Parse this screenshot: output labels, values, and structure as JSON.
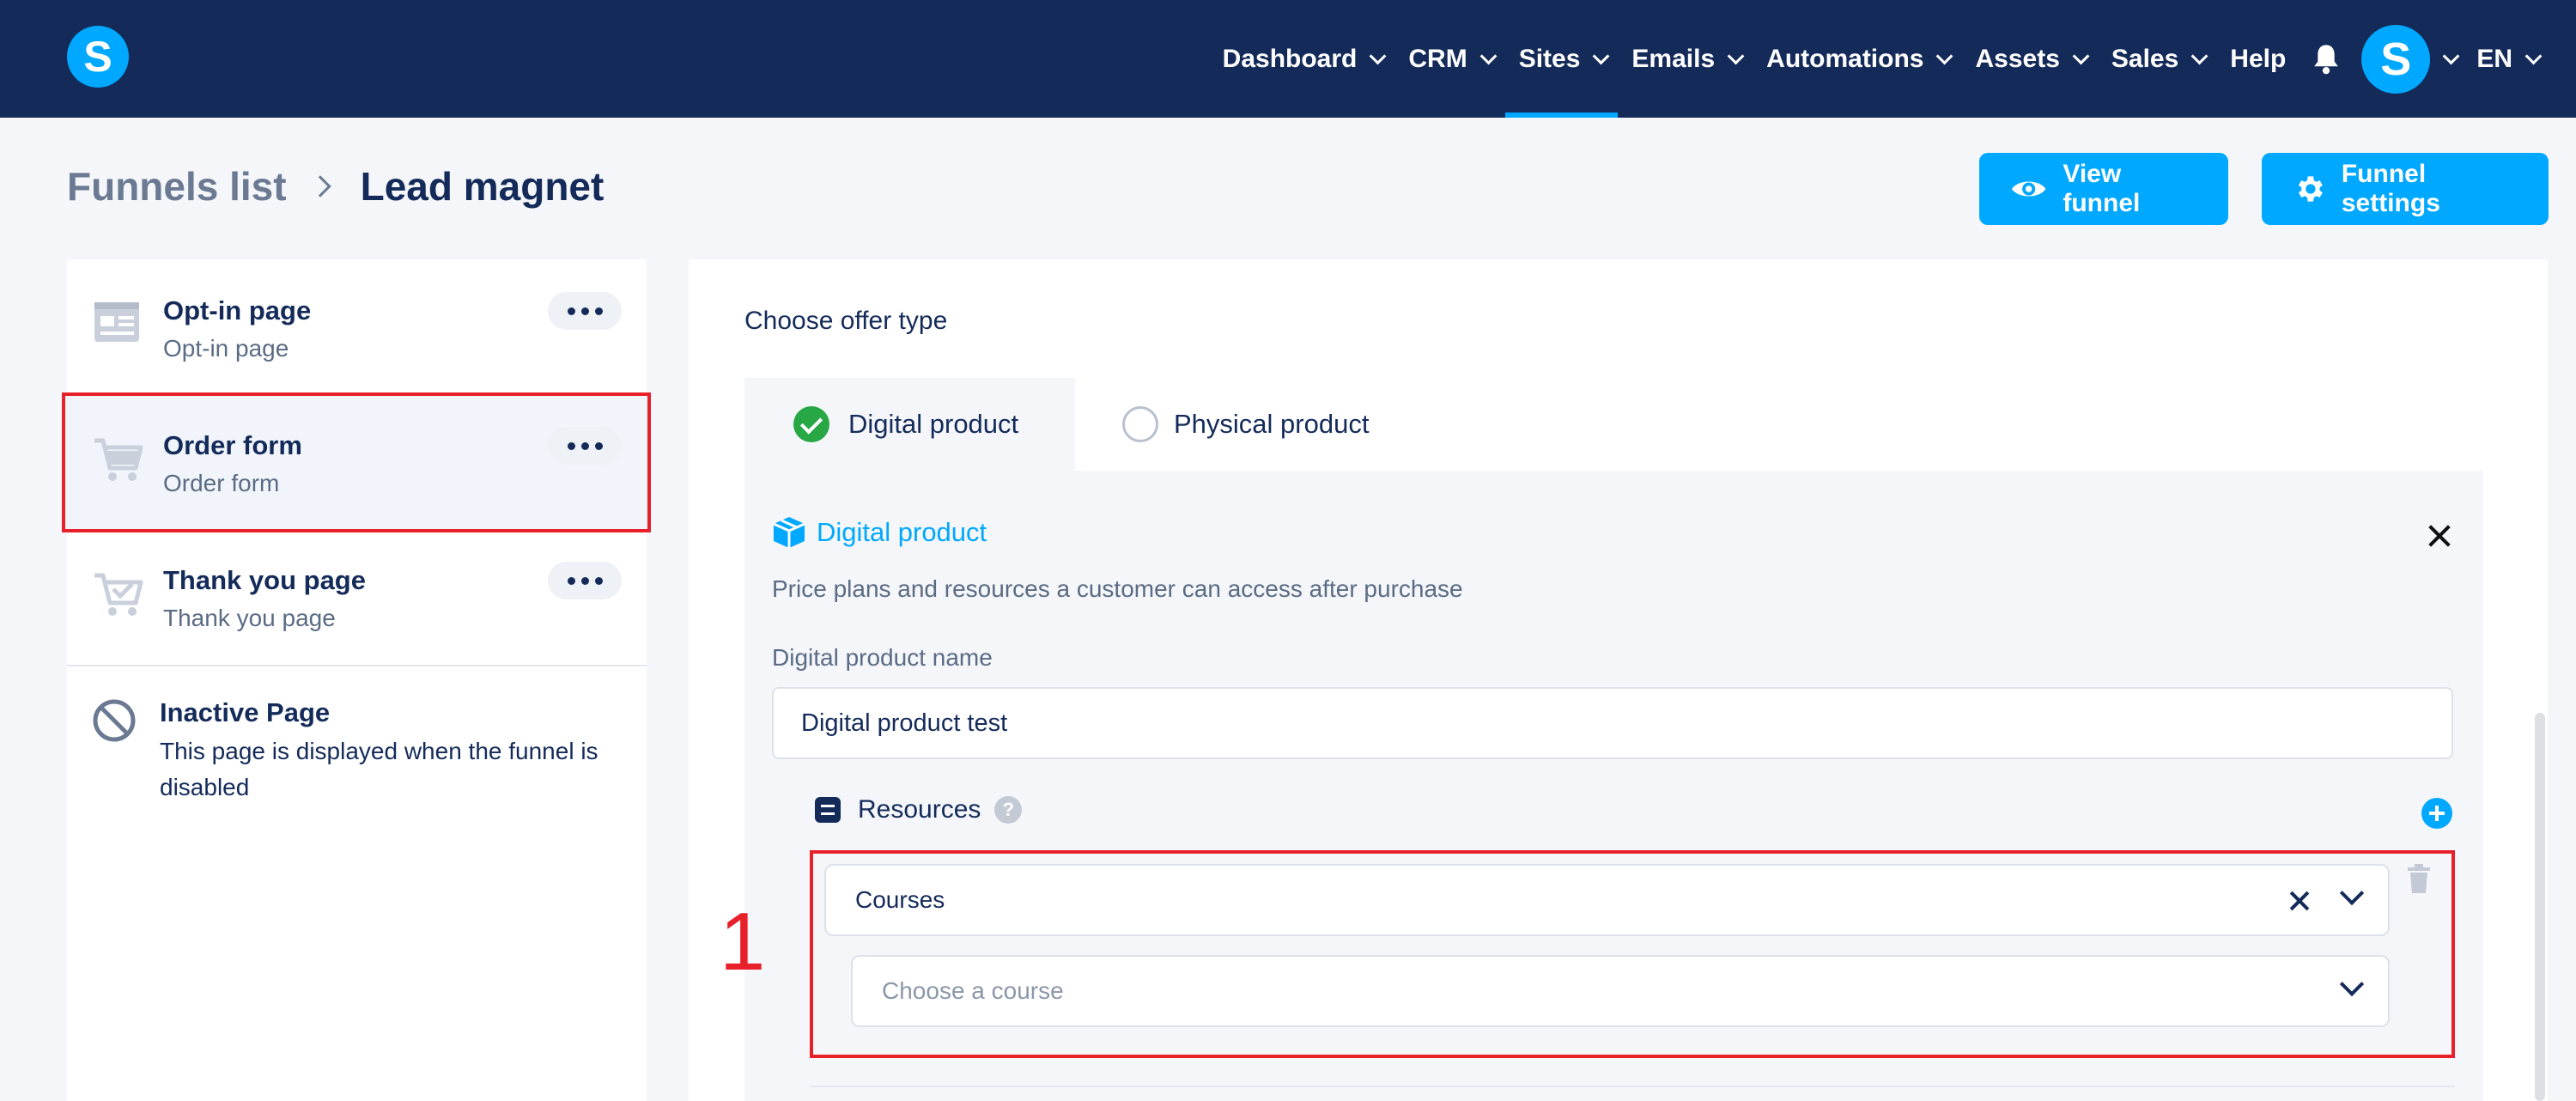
{
  "nav": {
    "items": [
      {
        "label": "Dashboard",
        "dropdown": true
      },
      {
        "label": "CRM",
        "dropdown": true
      },
      {
        "label": "Sites",
        "dropdown": true,
        "active": true
      },
      {
        "label": "Emails",
        "dropdown": true
      },
      {
        "label": "Automations",
        "dropdown": true
      },
      {
        "label": "Assets",
        "dropdown": true
      },
      {
        "label": "Sales",
        "dropdown": true
      },
      {
        "label": "Help",
        "dropdown": false
      }
    ],
    "language": "EN",
    "logo_letter": "S",
    "avatar_letter": "S"
  },
  "header": {
    "breadcrumb_root": "Funnels list",
    "breadcrumb_current": "Lead magnet",
    "view_button": "View funnel",
    "settings_button": "Funnel settings"
  },
  "sidebar": {
    "pages": [
      {
        "title": "Opt-in page",
        "subtitle": "Opt-in page",
        "icon": "form-icon"
      },
      {
        "title": "Order form",
        "subtitle": "Order form",
        "icon": "cart-icon",
        "selected": true
      },
      {
        "title": "Thank you page",
        "subtitle": "Thank you page",
        "icon": "cart-check-icon"
      }
    ],
    "inactive": {
      "title": "Inactive Page",
      "subtitle": "This page is displayed when the funnel is disabled",
      "icon": "ban-icon"
    }
  },
  "main": {
    "offer_label": "Choose offer type",
    "tabs": [
      {
        "label": "Digital product",
        "selected": true
      },
      {
        "label": "Physical product",
        "selected": false
      }
    ],
    "section_title": "Digital product",
    "section_desc": "Price plans and resources a customer can access after purchase",
    "name_label": "Digital product name",
    "name_value": "Digital product test",
    "resources_label": "Resources",
    "help_glyph": "?",
    "resource_type": "Courses",
    "course_placeholder": "Choose a course"
  },
  "annotation": {
    "marker": "1"
  },
  "colors": {
    "nav_bg": "#142b5a",
    "accent": "#00a8ff",
    "highlight": "#e8202a",
    "success": "#28a745"
  }
}
